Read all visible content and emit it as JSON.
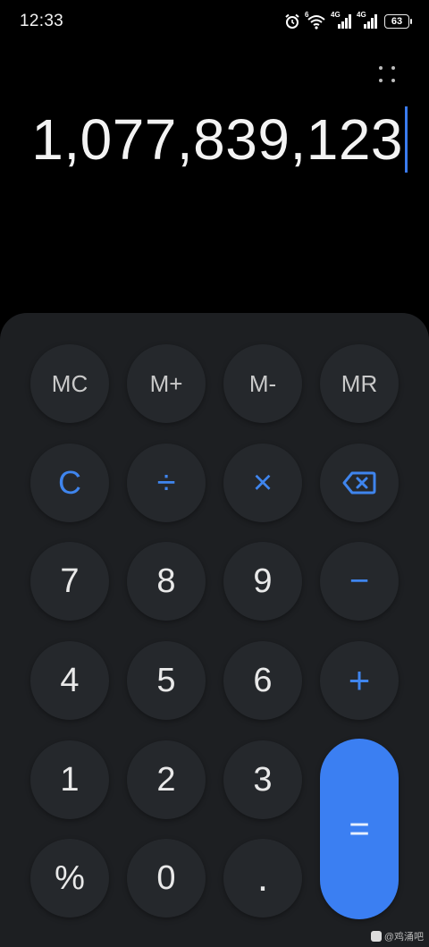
{
  "status_bar": {
    "time": "12:33",
    "wifi_tag": "6",
    "sim1_tag": "4G",
    "sim2_tag": "4G",
    "battery": "63"
  },
  "display": {
    "value": "1,077,839,123",
    "cursor_color": "#3a7bf0"
  },
  "keys": {
    "mc": "MC",
    "m_plus": "M+",
    "m_minus": "M-",
    "mr": "MR",
    "clear": "C",
    "divide": "÷",
    "multiply": "×",
    "backspace": "⌫",
    "seven": "7",
    "eight": "8",
    "nine": "9",
    "minus": "−",
    "four": "4",
    "five": "5",
    "six": "6",
    "plus": "+",
    "one": "1",
    "two": "2",
    "three": "3",
    "equals": "=",
    "percent": "%",
    "zero": "0",
    "decimal": "."
  },
  "watermark": {
    "text": "@鸡涌吧"
  },
  "colors": {
    "accent": "#3b7ff2",
    "key_bg": "#25282c",
    "panel_bg": "#1d1f22"
  }
}
